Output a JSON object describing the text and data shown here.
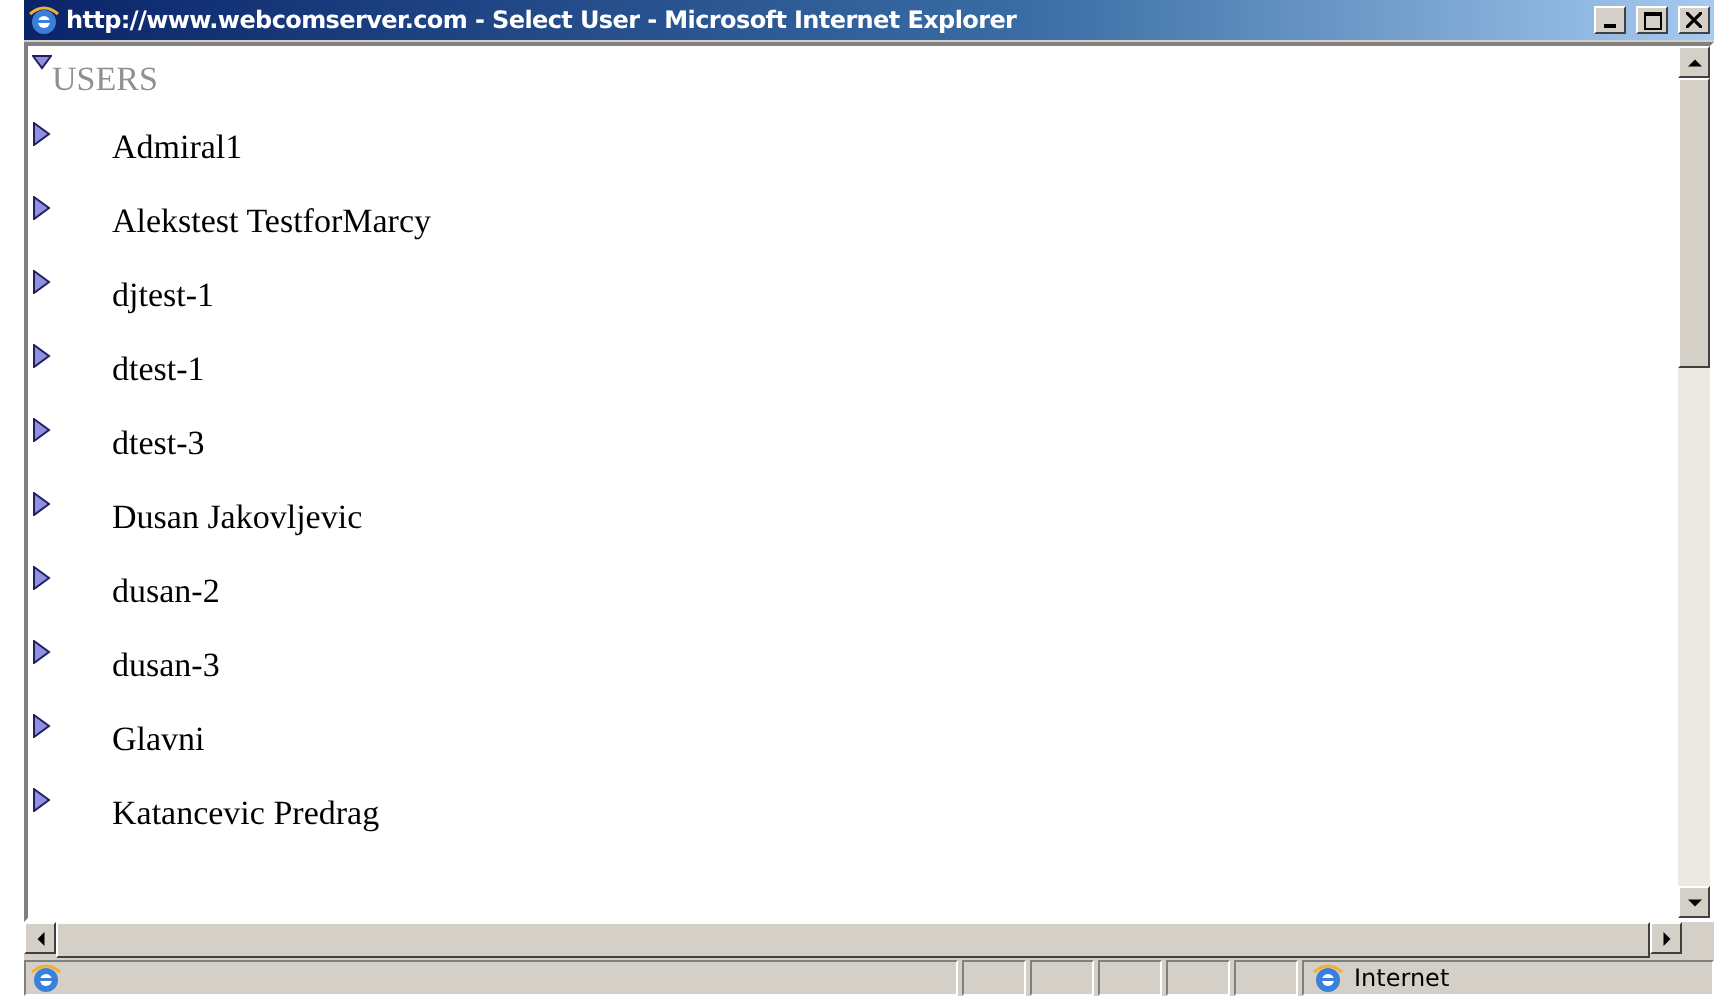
{
  "window": {
    "title": "http://www.webcomserver.com - Select User - Microsoft Internet Explorer"
  },
  "tree": {
    "label": "USERS",
    "expanded": true,
    "children": [
      {
        "label": "Admiral1",
        "expanded": false
      },
      {
        "label": "Alekstest TestforMarcy",
        "expanded": false
      },
      {
        "label": "djtest-1",
        "expanded": false
      },
      {
        "label": "dtest-1",
        "expanded": false
      },
      {
        "label": "dtest-3",
        "expanded": false
      },
      {
        "label": "Dusan Jakovljevic",
        "expanded": false
      },
      {
        "label": "dusan-2",
        "expanded": false
      },
      {
        "label": "dusan-3",
        "expanded": false
      },
      {
        "label": "Glavni",
        "expanded": false
      },
      {
        "label": "Katancevic Predrag",
        "expanded": false
      }
    ]
  },
  "status_bar": {
    "zone": "Internet"
  }
}
